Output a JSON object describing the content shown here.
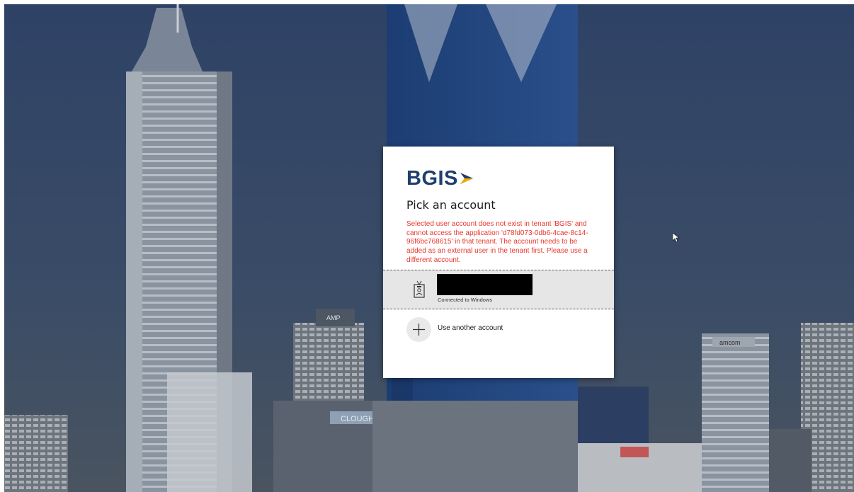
{
  "background": {
    "scene": "Perth city skyline with office towers",
    "building_signs": [
      "CLOUGH",
      "AMP",
      "amcom"
    ]
  },
  "dialog": {
    "logo": {
      "text": "BGIS",
      "arrow_color": "#f2a900",
      "text_color": "#1f3f6e"
    },
    "title": "Pick an account",
    "error_message": "Selected user account does not exist in tenant 'BGIS' and cannot access the application 'd78fd073-0db6-4cae-8c14-96f6bc768615' in that tenant. The account needs to be added as an external user in the tenant first. Please use a different account.",
    "error_color": "#e8382f",
    "accounts": [
      {
        "icon": "badge-icon",
        "name": "[redacted]",
        "status": "Connected to Windows"
      }
    ],
    "use_another_account": {
      "icon": "plus-icon",
      "label": "Use another account"
    }
  },
  "cursor": "mouse-pointer-icon"
}
